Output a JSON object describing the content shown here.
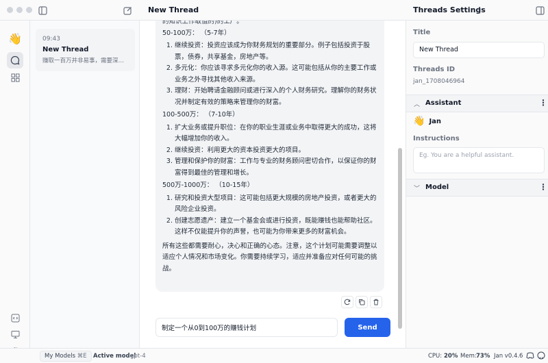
{
  "header": {
    "chat_title": "New Thread",
    "settings_title": "Threads Settings"
  },
  "threads": [
    {
      "time": "09:43",
      "title": "New Thread",
      "preview": "赚取一百万并非易事，需要深思..."
    }
  ],
  "message": {
    "top_cut_line": "的知识上作取值的)的工厂。",
    "sections": [
      {
        "heading": "50-100万： （5-7年）",
        "items": [
          "继续投资：投资应该成为你财务规划的重要部分。例子包括投资于股票，债券，共享基金，房地产等。",
          "多元化：你应该寻求多元化你的收入源。这可能包括从你的主要工作或业务之外寻找其他收入来源。",
          "理财：开始聘请金融顾问或进行深入的个人财务研究。理解你的财务状况并制定有效的策略来管理你的财富。"
        ]
      },
      {
        "heading": "100-500万： （7-10年）",
        "items": [
          "扩大业务或提升职位：在你的职业生涯或业务中取得更大的成功，这将大幅增加你的收入。",
          "继续投资：利用更大的资本投资更大的项目。",
          "管理和保护你的财富：工作与专业的财务顾问密切合作，以保证你的财富得到最佳的管理和增长。"
        ]
      },
      {
        "heading": "500万-1000万： （10-15年）",
        "items": [
          "研究和投资大型项目：这可能包括更大规模的房地产投资，或者更大的风险企业投资。",
          "创建志愿遗产：建立一个基金会或进行投资，既能赚钱也能帮助社区。这样不仅能提升你的声誉，也可能为你带来更多的财富机会。"
        ]
      }
    ],
    "closing": "所有这些都需要耐心，决心和正确的心态。注意，这个计划可能需要调整以适应个人情况和市场变化。你需要持续学习，适应并准备应对任何可能的挑战。"
  },
  "composer": {
    "value": "制定一个从0到100万的赚钱计划",
    "send_label": "Send"
  },
  "settings": {
    "title_label": "Title",
    "title_value": "New Thread",
    "thread_id_label": "Threads ID",
    "thread_id_value": "jan_1708046964",
    "assistant_section": "Assistant",
    "assistant_emoji": "👋",
    "assistant_name": "Jan",
    "instructions_label": "Instructions",
    "instructions_placeholder": "Eg. You are a helpful assistant.",
    "model_section": "Model"
  },
  "footer": {
    "my_models": "My Models",
    "shortcut": "⌘E",
    "active_model_label": "Active model",
    "active_model_value": "gpt-4",
    "cpu_label": "CPU:",
    "cpu_value": "20%",
    "mem_label": "Mem:",
    "mem_value": "73%",
    "version": "Jan v0.4.6"
  },
  "icons": {
    "logo": "waving-hand-icon",
    "chat": "chat-bubble-icon",
    "hub": "grid-icon",
    "api": "code-bracket-icon",
    "system": "monitor-icon",
    "settings": "gear-icon"
  }
}
